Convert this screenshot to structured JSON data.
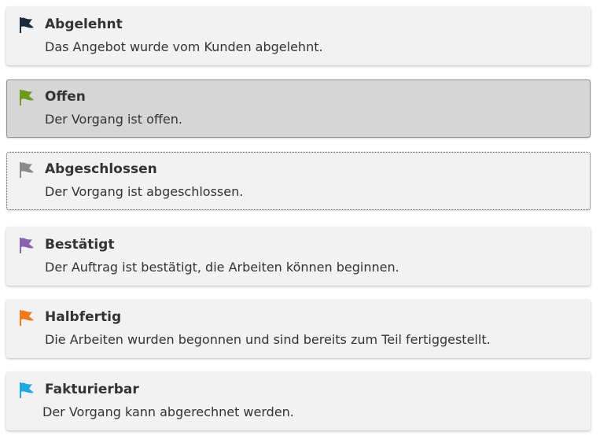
{
  "statuses": [
    {
      "title": "Abgelehnt",
      "description": "Das Angebot wurde vom Kunden abgelehnt.",
      "flag_icon": "flag-icon",
      "flag_color": "#1b2a3a",
      "state": "normal"
    },
    {
      "title": "Offen",
      "description": "Der Vorgang ist offen.",
      "flag_icon": "flag-icon",
      "flag_color": "#6c9a1a",
      "state": "selected"
    },
    {
      "title": "Abgeschlossen",
      "description": "Der Vorgang ist abgeschlossen.",
      "flag_icon": "flag-icon",
      "flag_color": "#8a8a8a",
      "state": "focused"
    },
    {
      "title": "Bestätigt",
      "description": "Der Auftrag ist bestätigt, die Arbeiten können beginnen.",
      "flag_icon": "flag-icon",
      "flag_color": "#8a62b0",
      "state": "normal"
    },
    {
      "title": "Halbfertig",
      "description": "Die Arbeiten wurden begonnen und sind bereits zum Teil fertiggestellt.",
      "flag_icon": "flag-icon",
      "flag_color": "#f07a1a",
      "state": "normal"
    },
    {
      "title": "Fakturierbar",
      "description": "Der Vorgang kann abgerechnet werden.",
      "flag_icon": "flag-icon",
      "flag_color": "#1fa8e0",
      "state": "normal"
    }
  ]
}
